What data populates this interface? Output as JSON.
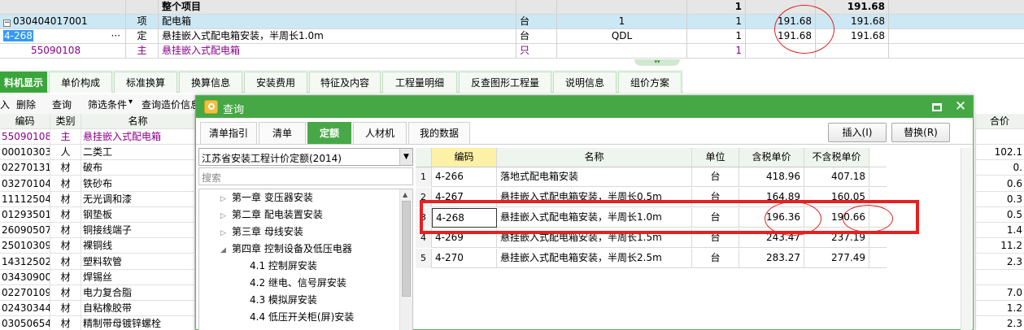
{
  "top_table": {
    "header_row": {
      "title": "整个项目",
      "qty": "1",
      "total": "191.68"
    },
    "rows": [
      {
        "code": "030404017001",
        "type": "项",
        "name": "配电箱",
        "unit": "台",
        "expr": "1",
        "qty": "1",
        "price": "191.68",
        "total": "191.68"
      },
      {
        "code": "4-268",
        "type": "定",
        "name": "悬挂嵌入式配电箱安装，半周长1.0m",
        "unit": "台",
        "expr": "QDL",
        "qty": "1",
        "price": "191.68",
        "total": "191.68"
      },
      {
        "code": "55090108",
        "type": "主",
        "name": "悬挂嵌入式配电箱",
        "unit": "只",
        "expr": "",
        "qty": "1",
        "price": "",
        "total": ""
      }
    ],
    "ellipsis": "···"
  },
  "bottom_tabs": [
    "料机显示",
    "单价构成",
    "标准换算",
    "换算信息",
    "安装费用",
    "特征及内容",
    "工程量明细",
    "反查图形工程量",
    "说明信息",
    "组价方案"
  ],
  "toolbar": {
    "items": [
      "入",
      "删除",
      "查询",
      "筛选条件",
      "查询造价信息"
    ],
    "dropdown_arrow": "▾"
  },
  "left_grid": {
    "headers": [
      "编码",
      "类别",
      "名称"
    ],
    "rows": [
      {
        "code": "55090108",
        "cat": "主",
        "name": "悬挂嵌入式配电箱"
      },
      {
        "code": "00010303",
        "cat": "人",
        "name": "二类工"
      },
      {
        "code": "02270131",
        "cat": "材",
        "name": "破布"
      },
      {
        "code": "03270104",
        "cat": "材",
        "name": "铁砂布"
      },
      {
        "code": "11112504",
        "cat": "材",
        "name": "无光调和漆"
      },
      {
        "code": "01293501",
        "cat": "材",
        "name": "钢垫板"
      },
      {
        "code": "26090507",
        "cat": "材",
        "name": "铜接线端子"
      },
      {
        "code": "25010309",
        "cat": "材",
        "name": "裸铜线"
      },
      {
        "code": "14312502",
        "cat": "材",
        "name": "塑料软管"
      },
      {
        "code": "03430900",
        "cat": "材",
        "name": "焊锡丝"
      },
      {
        "code": "02270109",
        "cat": "材",
        "name": "电力复合脂"
      },
      {
        "code": "02430344",
        "cat": "材",
        "name": "自粘橡胶带"
      },
      {
        "code": "03050654",
        "cat": "材",
        "name": "精制带母镀锌螺栓"
      }
    ]
  },
  "right_grid": {
    "header": "合价",
    "values": [
      "",
      "102.1",
      "0.",
      "0.6",
      "0.3",
      "0.5",
      "1.4",
      "11.2",
      "2.3",
      "",
      "7.0",
      "1.2",
      "2.3"
    ]
  },
  "dialog": {
    "title": "查询",
    "tabs": [
      "清单指引",
      "清单",
      "定额",
      "人材机",
      "我的数据"
    ],
    "insert_button": "插入(I)",
    "replace_button": "替换(R)",
    "quota_library": "江苏省安装工程计价定额(2014)",
    "search_placeholder": "搜索",
    "tree": [
      {
        "label": "第一章 变压器安装",
        "level": 0,
        "expanded": false
      },
      {
        "label": "第二章 配电装置安装",
        "level": 0,
        "expanded": false
      },
      {
        "label": "第三章 母线安装",
        "level": 0,
        "expanded": false
      },
      {
        "label": "第四章 控制设备及低压电器",
        "level": 0,
        "expanded": true
      },
      {
        "label": "4.1 控制屏安装",
        "level": 1
      },
      {
        "label": "4.2 继电、信号屏安装",
        "level": 1
      },
      {
        "label": "4.3 模拟屏安装",
        "level": 1
      },
      {
        "label": "4.4 低压开关柜(屏)安装",
        "level": 1
      }
    ],
    "grid_headers": [
      "编码",
      "名称",
      "单位",
      "含税单价",
      "不含税单价"
    ],
    "grid_rows": [
      {
        "n": "1",
        "code": "4-266",
        "name": "落地式配电箱安装",
        "unit": "台",
        "tax": "418.96",
        "notax": "407.18"
      },
      {
        "n": "2",
        "code": "4-267",
        "name": "悬挂嵌入式配电箱安装，半周长0.5m",
        "unit": "台",
        "tax": "164.89",
        "notax": "160.05"
      },
      {
        "n": "3",
        "code": "4-268",
        "name": "悬挂嵌入式配电箱安装，半周长1.0m",
        "unit": "台",
        "tax": "196.36",
        "notax": "190.66"
      },
      {
        "n": "4",
        "code": "4-269",
        "name": "悬挂嵌入式配电箱安装，半周长1.5m",
        "unit": "台",
        "tax": "243.47",
        "notax": "237.19"
      },
      {
        "n": "5",
        "code": "4-270",
        "name": "悬挂嵌入式配电箱安装，半周长2.5m",
        "unit": "台",
        "tax": "283.27",
        "notax": "277.49"
      }
    ]
  },
  "colors": {
    "accent": "#45a845",
    "highlight_row": "#cce8f4",
    "main_material": "#8b008b",
    "annotation": "#e02020"
  },
  "icons": {
    "minimize": "minimize-icon",
    "close": "close-icon",
    "app": "app-icon",
    "dropdown": "chevron-down-icon"
  }
}
